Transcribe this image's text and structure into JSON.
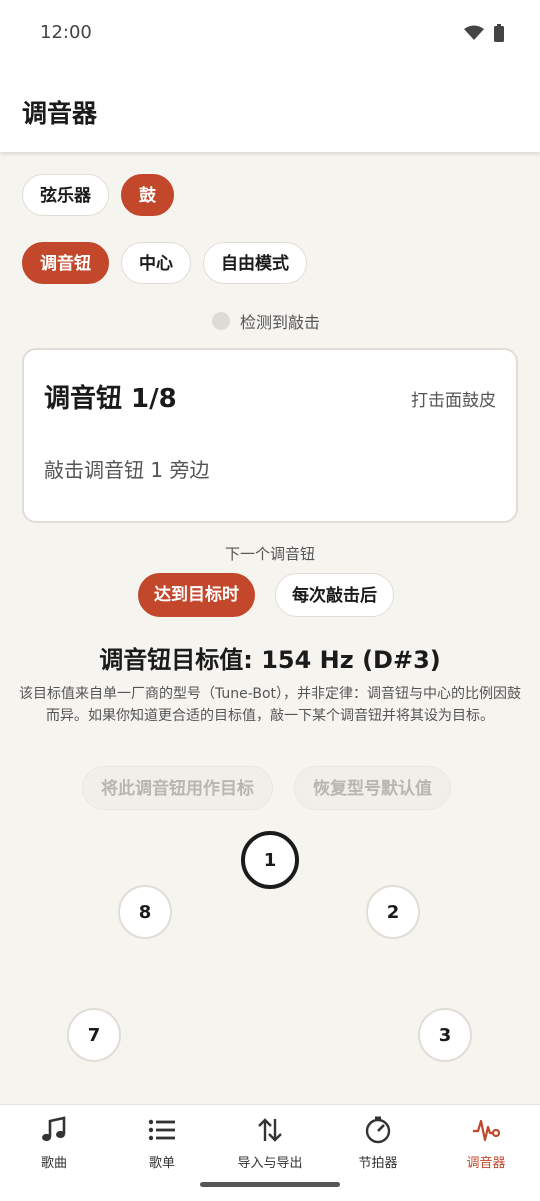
{
  "status": {
    "time": "12:00"
  },
  "app": {
    "title": "调音器"
  },
  "instrument_tabs": [
    {
      "label": "弦乐器"
    },
    {
      "label": "鼓"
    }
  ],
  "mode_tabs": [
    {
      "label": "调音钮"
    },
    {
      "label": "中心"
    },
    {
      "label": "自由模式"
    }
  ],
  "detect": {
    "label": "检测到敲击"
  },
  "card": {
    "title": "调音钮 1/8",
    "hint": "打击面鼓皮",
    "instruction": "敲击调音钮 1 旁边"
  },
  "next": {
    "label": "下一个调音钮",
    "options": [
      {
        "label": "达到目标时"
      },
      {
        "label": "每次敲击后"
      }
    ]
  },
  "target": {
    "title": "调音钮目标值: 154 Hz (D#3)",
    "description": "该目标值来自单一厂商的型号（Tune-Bot），并非定律：调音钮与中心的比例因鼓而异。如果你知道更合适的目标值，敲一下某个调音钮并将其设为目标。"
  },
  "actions": {
    "use_as_target": "将此调音钮用作目标",
    "restore_default": "恢复型号默认值"
  },
  "lugs": [
    "1",
    "2",
    "3",
    "7",
    "8"
  ],
  "nav": [
    {
      "label": "歌曲",
      "icon": "music-note-icon"
    },
    {
      "label": "歌单",
      "icon": "list-icon"
    },
    {
      "label": "导入与导出",
      "icon": "import-export-icon"
    },
    {
      "label": "节拍器",
      "icon": "metronome-icon"
    },
    {
      "label": "调音器",
      "icon": "tuner-waveform-icon"
    }
  ],
  "colors": {
    "accent": "#c2472b",
    "background": "#f6f4ef"
  }
}
